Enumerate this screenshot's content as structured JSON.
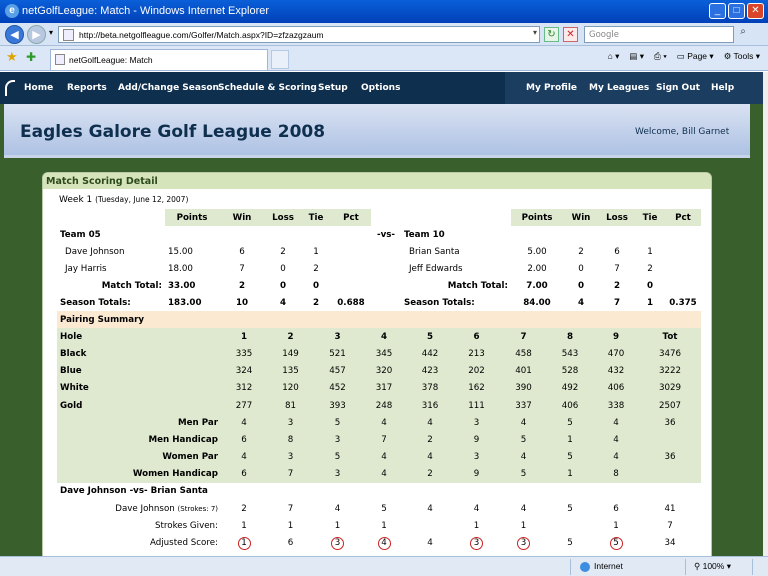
{
  "window": {
    "title": "netGolfLeague: Match - Windows Internet Explorer"
  },
  "address": {
    "url": "http://beta.netgolfleague.com/Golfer/Match.aspx?ID=zfzazgzaum",
    "search_placeholder": "Google"
  },
  "tab": {
    "label": "netGolfLeague: Match"
  },
  "toolbar": {
    "page": "Page",
    "tools": "Tools"
  },
  "menu": {
    "left": [
      "Home",
      "Reports",
      "Add/Change Season",
      "Schedule & Scoring",
      "Setup",
      "Options"
    ],
    "right": [
      "My Profile",
      "My Leagues",
      "Sign Out",
      "Help"
    ]
  },
  "banner": {
    "title": "Eagles Galore Golf League 2008",
    "welcome": "Welcome, Bill Garnet"
  },
  "panel": {
    "title": "Match Scoring Detail",
    "week": "Week 1",
    "date": "(Tuesday, June 12, 2007)"
  },
  "standings": {
    "headers": [
      "Points",
      "Win",
      "Loss",
      "Tie",
      "Pct"
    ],
    "vs": "-vs-",
    "left": {
      "team": "Team 05",
      "players": [
        {
          "name": "Dave Johnson",
          "points": "15.00",
          "win": "6",
          "loss": "2",
          "tie": "1"
        },
        {
          "name": "Jay Harris",
          "points": "18.00",
          "win": "7",
          "loss": "0",
          "tie": "2"
        }
      ],
      "match_total_label": "Match Total:",
      "match_total": {
        "points": "33.00",
        "win": "2",
        "loss": "0",
        "tie": "0"
      },
      "season_label": "Season Totals:",
      "season": {
        "points": "183.00",
        "win": "10",
        "loss": "4",
        "tie": "2",
        "pct": "0.688"
      }
    },
    "right": {
      "team": "Team 10",
      "players": [
        {
          "name": "Brian Santa",
          "points": "5.00",
          "win": "2",
          "loss": "6",
          "tie": "1"
        },
        {
          "name": "Jeff Edwards",
          "points": "2.00",
          "win": "0",
          "loss": "7",
          "tie": "2"
        }
      ],
      "match_total_label": "Match Total:",
      "match_total": {
        "points": "7.00",
        "win": "0",
        "loss": "2",
        "tie": "0"
      },
      "season_label": "Season Totals:",
      "season": {
        "points": "84.00",
        "win": "4",
        "loss": "7",
        "tie": "1",
        "pct": "0.375"
      }
    }
  },
  "scorecard": {
    "section": "Pairing Summary",
    "rows": [
      {
        "label": "Hole",
        "values": [
          "1",
          "2",
          "3",
          "4",
          "5",
          "6",
          "7",
          "8",
          "9",
          "Tot"
        ]
      },
      {
        "label": "Black",
        "values": [
          "335",
          "149",
          "521",
          "345",
          "442",
          "213",
          "458",
          "543",
          "470",
          "3476"
        ]
      },
      {
        "label": "Blue",
        "values": [
          "324",
          "135",
          "457",
          "320",
          "423",
          "202",
          "401",
          "528",
          "432",
          "3222"
        ]
      },
      {
        "label": "White",
        "values": [
          "312",
          "120",
          "452",
          "317",
          "378",
          "162",
          "390",
          "492",
          "406",
          "3029"
        ]
      },
      {
        "label": "Gold",
        "values": [
          "277",
          "81",
          "393",
          "248",
          "316",
          "111",
          "337",
          "406",
          "338",
          "2507"
        ]
      },
      {
        "label": "Men Par",
        "values": [
          "4",
          "3",
          "5",
          "4",
          "4",
          "3",
          "4",
          "5",
          "4",
          "36"
        ]
      },
      {
        "label": "Men Handicap",
        "values": [
          "6",
          "8",
          "3",
          "7",
          "2",
          "9",
          "5",
          "1",
          "4",
          ""
        ]
      },
      {
        "label": "Women Par",
        "values": [
          "4",
          "3",
          "5",
          "4",
          "4",
          "3",
          "4",
          "5",
          "4",
          "36"
        ]
      },
      {
        "label": "Women Handicap",
        "values": [
          "6",
          "7",
          "3",
          "4",
          "2",
          "9",
          "5",
          "1",
          "8",
          ""
        ]
      }
    ],
    "pairing": {
      "title": "Dave Johnson -vs- Brian Santa",
      "player_label": "Dave Johnson",
      "strokes_note": "(Strokes: 7)",
      "player_scores": [
        "2",
        "7",
        "4",
        "5",
        "4",
        "4",
        "4",
        "5",
        "6",
        "41"
      ],
      "given_label": "Strokes Given:",
      "given": [
        "1",
        "1",
        "1",
        "1",
        "",
        "1",
        "1",
        "",
        "1",
        "7"
      ],
      "adjusted_label": "Adjusted Score:",
      "adjusted": [
        "1",
        "6",
        "3",
        "4",
        "4",
        "3",
        "3",
        "5",
        "5",
        "34"
      ],
      "adjusted_circled": [
        true,
        false,
        true,
        true,
        false,
        true,
        true,
        false,
        true,
        false
      ]
    }
  },
  "status": {
    "zone": "Internet",
    "zoom": "100%"
  }
}
